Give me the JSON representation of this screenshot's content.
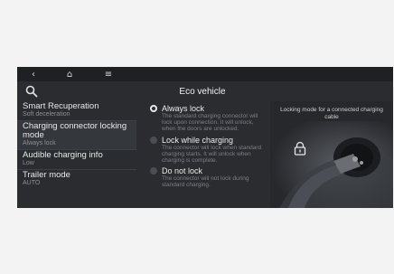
{
  "topbar": {
    "back_glyph": "‹",
    "home_glyph": "⌂",
    "menu_glyph": "≡"
  },
  "screen": {
    "title": "Eco vehicle"
  },
  "menu": [
    {
      "title": "Smart Recuperation",
      "subtitle": "Soft deceleration"
    },
    {
      "title": "Charging connector locking mode",
      "subtitle": "Always lock"
    },
    {
      "title": "Audible charging info",
      "subtitle": "Low"
    },
    {
      "title": "Trailer mode",
      "subtitle": "AUTO"
    }
  ],
  "options": [
    {
      "title": "Always lock",
      "description": "The standard charging connector will lock upon connection. It will unlock, when the doors are unlocked.",
      "selected": true
    },
    {
      "title": "Lock while charging",
      "description": "The connector will lock when standard charging starts. It will unlock when charging is complete.",
      "selected": false
    },
    {
      "title": "Do not lock",
      "description": "The connector will not lock during standard charging.",
      "selected": false
    }
  ],
  "panel": {
    "caption": "Locking mode for a connected charging cable",
    "icon": "padlock-icon",
    "illustration": "charging-plug"
  },
  "colors": {
    "screen_bg": "#2a2c30",
    "accent_text": "#ececec",
    "muted_text": "#7c7f84"
  }
}
